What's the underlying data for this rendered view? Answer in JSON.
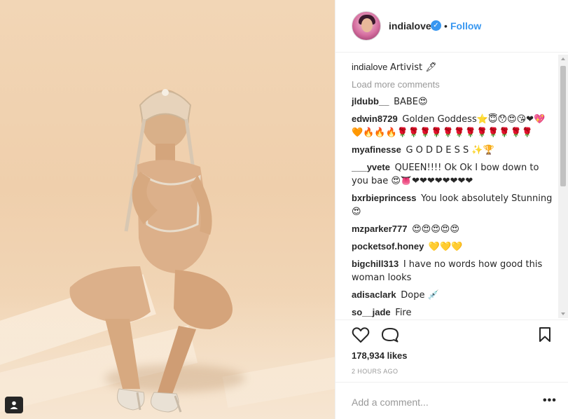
{
  "post": {
    "author": "indialove",
    "follow_label": "Follow",
    "verified_icon": "verified-badge-icon",
    "dot": "•"
  },
  "caption": {
    "username": "indialove",
    "text": "Artivist 🖋"
  },
  "load_more_label": "Load more comments",
  "comments": [
    {
      "username": "jldubb__",
      "text": "BABE😍"
    },
    {
      "username": "edwin8729",
      "text": "Golden Goddess⭐😇😯😍😘❤💖🧡🔥🔥🔥🌹🌹🌹🌹🌹🌹🌹🌹🌹🌹🌹🌹"
    },
    {
      "username": "myafinesse",
      "text": "G O D D E S S ✨🏆"
    },
    {
      "username": "___yvete",
      "text": "QUEEN!!!! Ok Ok I bow down to you bae 😍👅❤❤❤❤❤❤❤❤"
    },
    {
      "username": "bxrbieprincess",
      "text": "You look absolutely Stunning 😍"
    },
    {
      "username": "mzparker777",
      "text": "😍😍😍😍😍"
    },
    {
      "username": "pocketsof.honey",
      "text": "💛💛💛"
    },
    {
      "username": "bigchill313",
      "text": "I have no words how good this woman looks"
    },
    {
      "username": "adisaclark",
      "text": "Dope 💉"
    },
    {
      "username": "so__jade",
      "text": "Fire"
    }
  ],
  "likes_text": "178,934 likes",
  "time_text": "2 HOURS AGO",
  "add_comment_placeholder": "Add a comment...",
  "more_options_label": "•••",
  "colors": {
    "link_blue": "#3897f0",
    "text": "#262626",
    "muted": "#999999",
    "border": "#efefef"
  },
  "icons": [
    "heart-icon",
    "comment-icon",
    "bookmark-icon",
    "user-tag-icon",
    "verified-badge-icon"
  ]
}
